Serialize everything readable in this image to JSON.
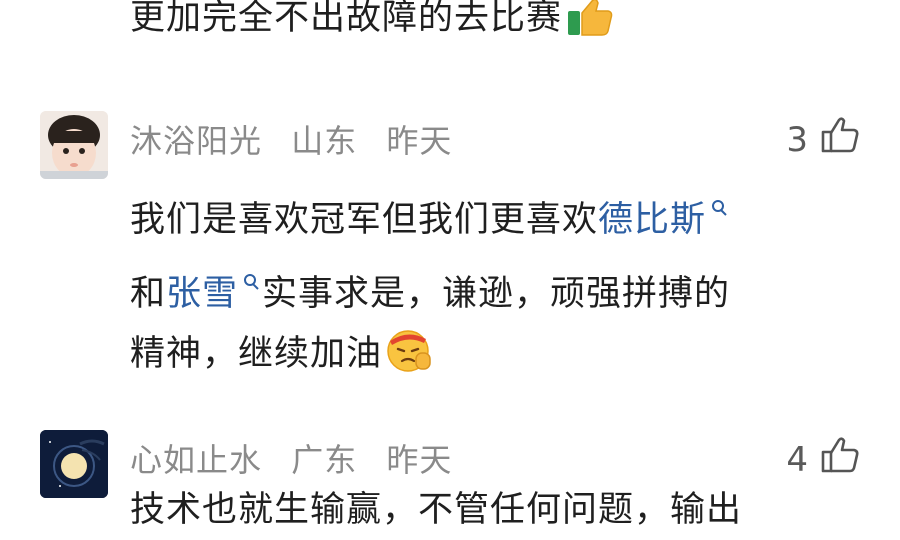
{
  "previous_comment": {
    "tail_text": "更加完全不出故障的去比赛"
  },
  "comments": [
    {
      "username": "沐浴阳光",
      "location": "山东",
      "time": "昨天",
      "likes": "3",
      "text_part1": "我们是喜欢冠军但我们更喜欢",
      "topic1": "德比斯",
      "text_part2": "和",
      "topic2": "张雪",
      "text_part3": "实事求是，谦逊，顽强拼搏的",
      "text_part4": "精神，继续加油"
    },
    {
      "username": "心如止水",
      "location": "广东",
      "time": "昨天",
      "likes": "4",
      "text_partial": "技术也就生输赢，不管任何问题，输出"
    }
  ],
  "icons": {
    "like": "thumbs-up-outline-icon",
    "search": "search-icon",
    "thumbs_emoji": "thumbs-up-emoji",
    "salute_emoji": "salute-emoji"
  }
}
